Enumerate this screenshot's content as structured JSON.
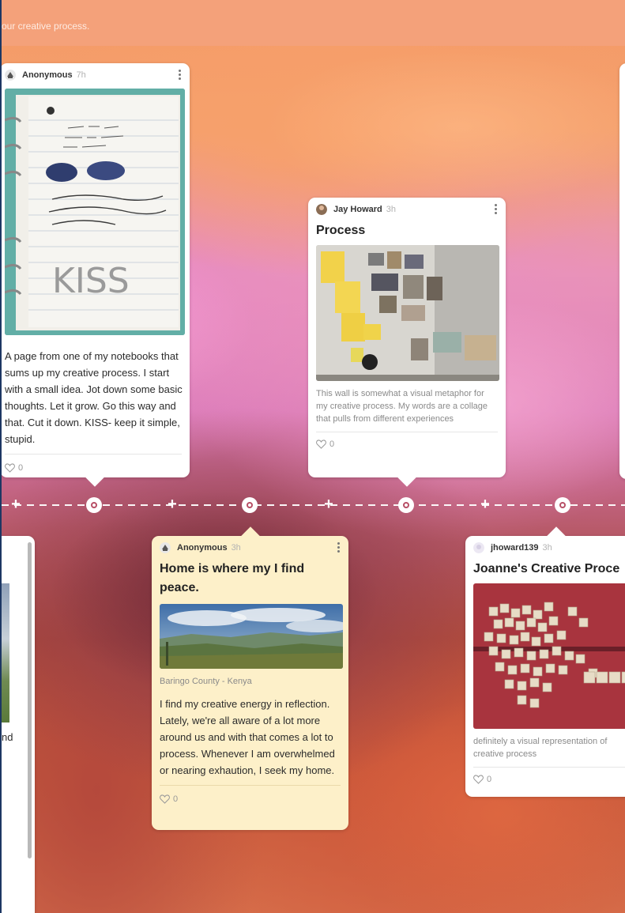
{
  "header": {
    "subtitle": "our creative process."
  },
  "cards": {
    "c1": {
      "author": "Anonymous",
      "time": "7h",
      "text": "A page from one of my notebooks that sums up my creative process. I start with a small idea. Jot down some basic thoughts. Let it grow. Go this way and that. Cut it down. KISS- keep it simple, stupid.",
      "likes": "0",
      "image_icon": "notebook-image"
    },
    "c2": {
      "author": "Jay Howard",
      "time": "3h",
      "title": "Process",
      "caption": "This wall is somewhat a visual metaphor for my creative process. My words are a collage that pulls from different experiences",
      "likes": "0",
      "image_icon": "wall-collage-image"
    },
    "c3": {
      "author": "Anonymous",
      "time": "3h",
      "title": "Home is where my I find peace.",
      "location": "Baringo County - Kenya",
      "text": "I find my creative energy in reflection. Lately, we're all aware of a lot more around us and with that comes a lot to process. Whenever I am overwhelmed or nearing exhaution, I seek my home.",
      "likes": "0",
      "image_icon": "landscape-image"
    },
    "c4": {
      "author": "jhoward139",
      "time": "3h",
      "title": "Joanne's Creative Proce",
      "caption": "definitely a visual representation of creative process",
      "likes": "0",
      "image_icon": "scrabble-tiles-image"
    },
    "c5": {
      "fragment": "nd"
    }
  },
  "colors": {
    "header": "#f4a17a",
    "card": "#ffffff",
    "card_yellow": "#fdf0c9",
    "node_ring": "#b74f66"
  }
}
